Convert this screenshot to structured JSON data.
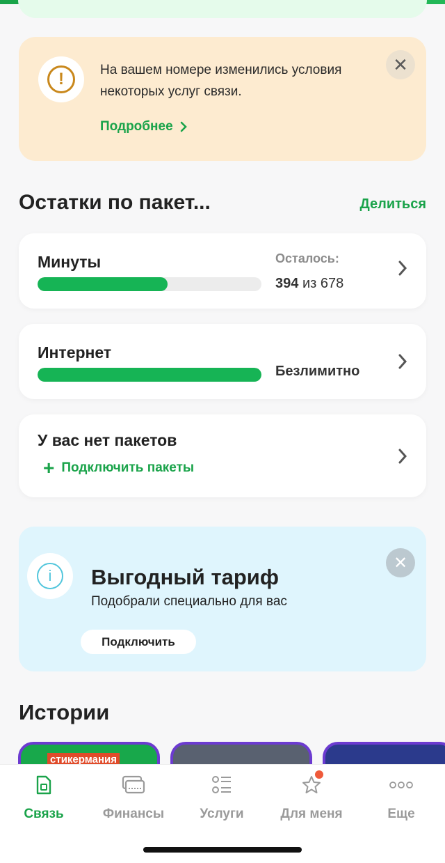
{
  "notice": {
    "text": "На вашем номере изменились условия некоторых услуг связи.",
    "more_label": "Подробнее",
    "close_symbol": "✕",
    "warning_symbol": "!"
  },
  "packages": {
    "title": "Остатки по пакет...",
    "share_label": "Делиться",
    "minutes": {
      "name": "Минуты",
      "remain_label": "Осталось:",
      "remaining": "394",
      "of_word": "из",
      "total": "678",
      "progress_fraction": 0.58
    },
    "internet": {
      "name": "Интернет",
      "status": "Безлимитно",
      "progress_fraction": 1.0
    },
    "none": {
      "name": "У вас нет пакетов",
      "connect_label": "Подключить пакеты"
    }
  },
  "promo": {
    "title": "Выгодный тариф",
    "subtitle": "Подобрали специально для вас",
    "button_label": "Подключить",
    "info_symbol": "i",
    "close_symbol": "✕"
  },
  "stories": {
    "title": "Истории",
    "first_tag": "стикермания"
  },
  "tabbar": {
    "tabs": [
      {
        "label": "Связь",
        "icon": "sim-card-icon",
        "active": true
      },
      {
        "label": "Финансы",
        "icon": "wallet-icon",
        "active": false
      },
      {
        "label": "Услуги",
        "icon": "services-list-icon",
        "active": false
      },
      {
        "label": "Для меня",
        "icon": "star-icon",
        "active": false
      },
      {
        "label": "Еще",
        "icon": "more-dots-icon",
        "active": false
      }
    ]
  },
  "colors": {
    "accent": "#1aa34a",
    "notice_bg": "#fdebd0",
    "promo_bg": "#dff5fd",
    "badge": "#ef5a3a"
  }
}
